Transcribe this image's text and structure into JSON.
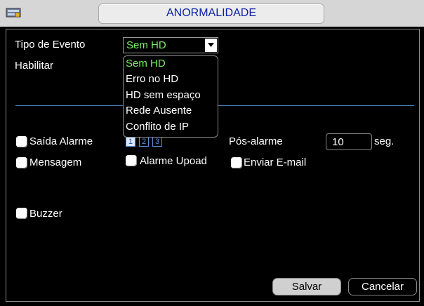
{
  "window": {
    "title": "ANORMALIDADE"
  },
  "tipo_evento": {
    "label": "Tipo de Evento",
    "selected": "Sem HD",
    "options": [
      "Sem HD",
      "Erro no HD",
      "HD sem espaço",
      "Rede Ausente",
      "Conflito de IP"
    ]
  },
  "habilitar": {
    "label": "Habilitar"
  },
  "saida_alarme": {
    "label": "Saída Alarme",
    "channels": [
      "1",
      "2",
      "3"
    ]
  },
  "pos_alarme": {
    "label": "Pós-alarme",
    "value": "10",
    "unit": "seg."
  },
  "mensagem": {
    "label": "Mensagem"
  },
  "alarme_upload": {
    "label": "Alarme Upoad"
  },
  "enviar_email": {
    "label": "Enviar E-mail"
  },
  "buzzer": {
    "label": "Buzzer"
  },
  "buttons": {
    "save": "Salvar",
    "cancel": "Cancelar"
  },
  "colors": {
    "selected_text": "#7bf062",
    "title_text": "#0a1fa8",
    "divider": "#4a82c0"
  }
}
